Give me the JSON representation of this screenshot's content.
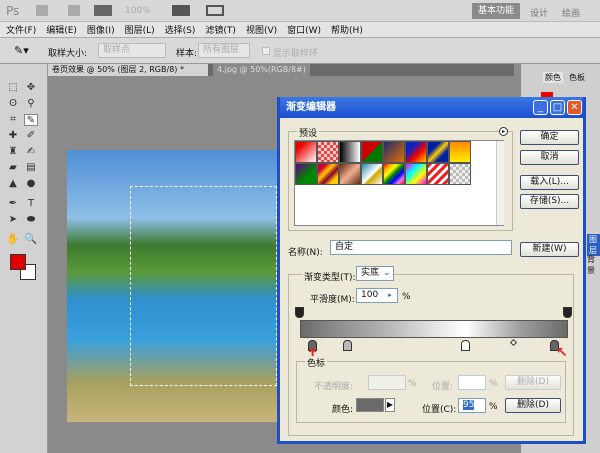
{
  "app": {
    "logo": "Ps",
    "zoom": "100%",
    "workspaces": [
      "基本功能",
      "设计",
      "绘画"
    ]
  },
  "menu": [
    "文件(F)",
    "编辑(E)",
    "图像(I)",
    "图层(L)",
    "选择(S)",
    "滤镜(T)",
    "视图(V)",
    "窗口(W)",
    "帮助(H)"
  ],
  "options": {
    "sample_size_label": "取样大小:",
    "sample_size_value": "取样点",
    "sample_label": "样本:",
    "sample_value": "所有图层",
    "show_ring": "显示取样环"
  },
  "doc_tabs": [
    {
      "label": "卷页效果 @ 50% (图层 2, RGB/8) *",
      "active": true
    },
    {
      "label": "4.jpg @ 50%(RGB/8#)",
      "active": false
    }
  ],
  "right_panel": {
    "tabs": [
      "颜色",
      "色板"
    ],
    "items": [
      "图层",
      "背景"
    ]
  },
  "colors": {
    "foreground": "#e00000",
    "background": "#ffffff",
    "accent": "#1f4fc6"
  },
  "dialog": {
    "title": "渐变编辑器",
    "presets_label": "预设",
    "presets": [
      "linear-gradient(135deg,#e00 20%,#fff)",
      "repeating-conic-gradient(#e44 0 25%,#fcc 0 50%) 0 0/6px 6px",
      "linear-gradient(90deg,#000,#fff)",
      "linear-gradient(135deg,#c00 50%,#070 50%)",
      "linear-gradient(135deg,#222a70,#e07000)",
      "linear-gradient(135deg,#1020c0 30%,#e00 60%,#fc0)",
      "linear-gradient(135deg,#0020a0 30%,#fc0 50%,#0020a0 70%)",
      "linear-gradient(180deg,#f80,#fe0)",
      "linear-gradient(135deg,#600080,#080 60%)",
      "linear-gradient(135deg,#c03 20%,#fc0 40%,#803 60%,#fc0 80%)",
      "linear-gradient(135deg,#602a10,#f0b090 50%,#602a10)",
      "linear-gradient(135deg,#28a,#fff 50%,#ca0 60%,#fff)",
      "linear-gradient(135deg,red,orange,yellow,green,blue,violet,red)",
      "linear-gradient(135deg,#f0f,#0ff,#ff0,#f0f)",
      "repeating-linear-gradient(135deg,#e22 0 3px,#fff 3px 6px)",
      "repeating-conic-gradient(#bbb 0 25%,#eee 0 50%) 0 0/6px 6px"
    ],
    "buttons": {
      "ok": "确定",
      "cancel": "取消",
      "load": "载入(L)...",
      "save": "存储(S)...",
      "new": "新建(W)"
    },
    "name_label": "名称(N):",
    "name_value": "自定",
    "type_label": "渐变类型(T):",
    "type_value": "实底",
    "smooth_label": "平滑度(M):",
    "smooth_value": "100",
    "percent": "%",
    "gradient": "linear-gradient(90deg,#6a6a6a 0%,#8a8a8a 12%,#b0b0b0 30%,#f0f0f0 55%,#ffffff 62%,#a0a0a0 82%,#6a6a6a 100%)",
    "stops": {
      "opacity": [
        0,
        100
      ],
      "color": [
        5,
        18,
        62,
        95
      ],
      "midpoint": 80
    },
    "stops_group": {
      "label": "色标",
      "opacity_label": "不透明度:",
      "location_label": "位置:",
      "delete": "删除(D)",
      "color_label": "颜色:",
      "color_value": "#6a6a6a",
      "location_c_label": "位置(C):",
      "location_value": "95"
    }
  }
}
